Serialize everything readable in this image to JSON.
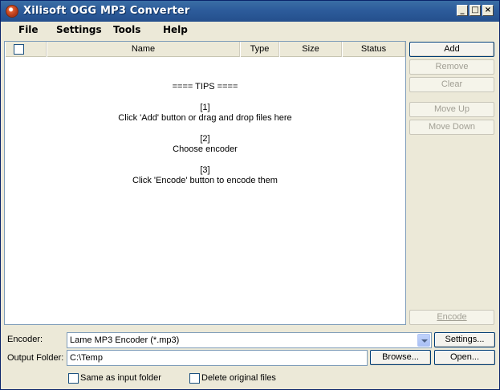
{
  "window": {
    "title": "Xilisoft OGG MP3 Converter",
    "controls": {
      "minimize": "_",
      "maximize": "□",
      "close": "×"
    }
  },
  "menu": {
    "file": "File",
    "settings": "Settings",
    "tools": "Tools",
    "help": "Help"
  },
  "list": {
    "columns": {
      "name": "Name",
      "type": "Type",
      "size": "Size",
      "status": "Status"
    },
    "tips": {
      "heading": "==== TIPS ====",
      "step1_num": "[1]",
      "step1_text": "Click 'Add' button or drag and drop files here",
      "step2_num": "[2]",
      "step2_text": "Choose encoder",
      "step3_num": "[3]",
      "step3_text": "Click 'Encode' button to encode them"
    }
  },
  "buttons": {
    "add": "Add",
    "remove": "Remove",
    "clear": "Clear",
    "move_up": "Move Up",
    "move_down": "Move Down",
    "encode": "Encode",
    "settings": "Settings...",
    "browse": "Browse...",
    "open": "Open..."
  },
  "form": {
    "encoder_label": "Encoder:",
    "encoder_value": "Lame MP3 Encoder    (*.mp3)",
    "output_label": "Output Folder:",
    "output_value": "C:\\Temp",
    "same_as_input": "Same as input folder",
    "delete_original": "Delete original files"
  }
}
